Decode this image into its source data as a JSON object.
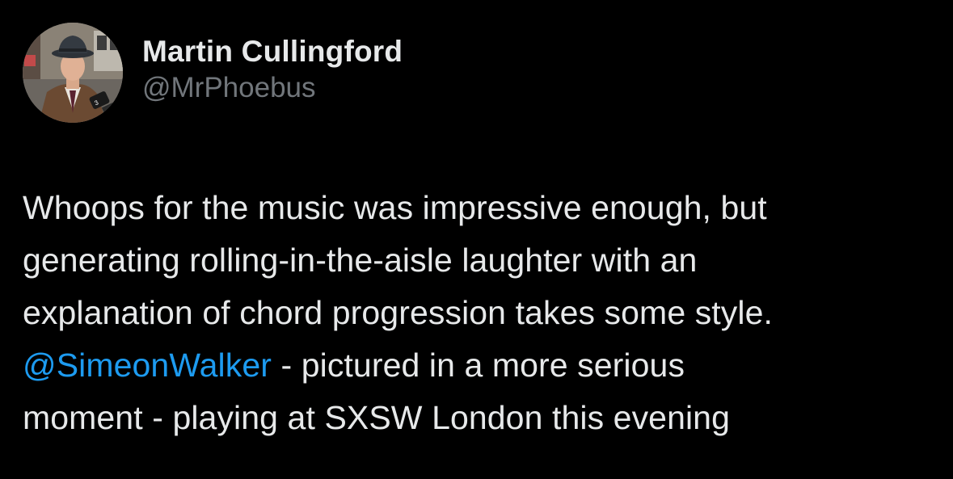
{
  "author": {
    "display_name": "Martin Cullingford",
    "handle": "@MrPhoebus",
    "avatar_icon": "profile-photo"
  },
  "tweet": {
    "lines": [
      "Whoops for the music was impressive enough, but",
      "generating rolling-in-the-aisle laughter with an",
      "explanation of chord progression takes some style."
    ],
    "mention": "@SimeonWalker",
    "line4_rest": " - pictured in a more serious",
    "line5": "moment - playing at SXSW London this evening"
  },
  "colors": {
    "background": "#000000",
    "text": "#e7e9ea",
    "secondary": "#71767b",
    "link": "#1d9bf0"
  }
}
